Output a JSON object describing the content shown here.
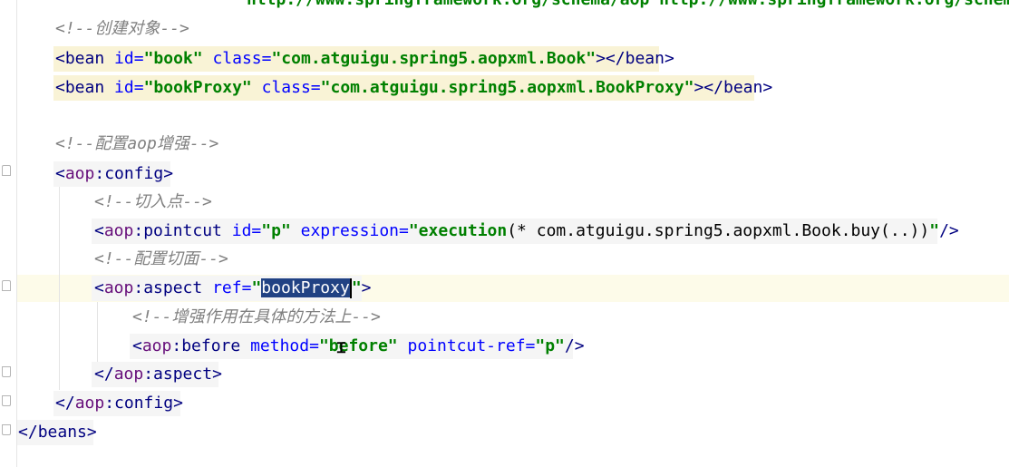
{
  "editor": {
    "line0": {
      "url1": "http://www.springframework.org/schema/aop",
      "url2": "http://www.springframework.org/schema/"
    },
    "line1": {
      "comment": "<!--创建对象-->"
    },
    "line2": {
      "open": "<",
      "tag": "bean",
      "attr1": "id=",
      "val1": "\"book\"",
      "attr2": "class=",
      "val2": "\"com.atguigu.spring5.aopxml.Book\"",
      "end": "></",
      "closetag": "bean",
      "close": ">"
    },
    "line3": {
      "open": "<",
      "tag": "bean",
      "attr1": "id=",
      "val1": "\"bookProxy\"",
      "attr2": "class=",
      "val2": "\"com.atguigu.spring5.aopxml.BookProxy\"",
      "end": "></",
      "closetag": "bean",
      "close": ">"
    },
    "line5": {
      "comment": "<!--配置aop增强-->"
    },
    "line6": {
      "open": "<",
      "ns": "aop",
      "colon": ":",
      "tag": "config",
      "close": ">"
    },
    "line7": {
      "comment": "<!--切入点-->"
    },
    "line8": {
      "open": "<",
      "ns": "aop",
      "colon": ":",
      "tag": "pointcut",
      "attr1": "id=",
      "val1": "\"p\"",
      "attr2": "expression=",
      "val2a": "\"execution",
      "val2b": "(* com.atguigu.spring5.aopxml.Book.buy(..))",
      "val2c": "\"",
      "close": "/>"
    },
    "line9": {
      "comment": "<!--配置切面-->"
    },
    "line10": {
      "open": "<",
      "ns": "aop",
      "colon": ":",
      "tag": "aspect",
      "attr1": "ref=",
      "q1": "\"",
      "selected": "bookProxy",
      "q2": "\"",
      "close": ">"
    },
    "line11": {
      "comment": "<!--增强作用在具体的方法上-->"
    },
    "line12": {
      "open": "<",
      "ns": "aop",
      "colon": ":",
      "tag": "before",
      "attr1": "method=",
      "val1": "\"before\"",
      "attr2": "pointcut-ref=",
      "val2": "\"p\"",
      "close": "/>"
    },
    "line13": {
      "open": "</",
      "ns": "aop",
      "colon": ":",
      "tag": "aspect",
      "close": ">"
    },
    "line14": {
      "open": "</",
      "ns": "aop",
      "colon": ":",
      "tag": "config",
      "close": ">"
    },
    "line15": {
      "open": "</",
      "tag": "beans",
      "close": ">"
    }
  },
  "colors": {
    "tag": "#000080",
    "attribute": "#0000ff",
    "value": "#008000",
    "comment": "#808080",
    "selection": "#214283",
    "caret_row": "#fdfbe9",
    "tag_highlight": "#f9f3d6"
  }
}
